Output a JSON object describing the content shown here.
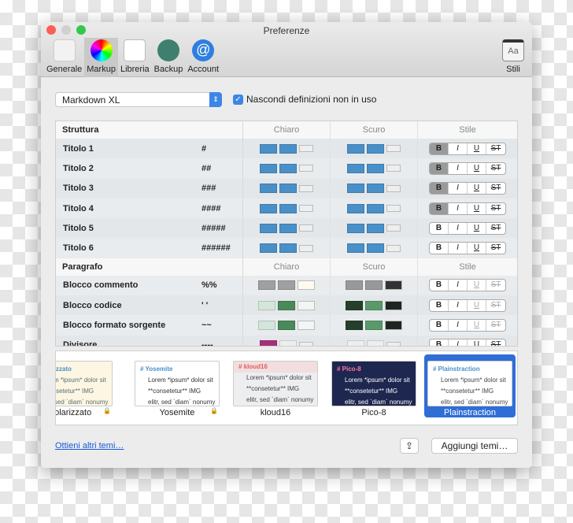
{
  "window": {
    "title": "Preferenze"
  },
  "toolbar": {
    "items": [
      {
        "label": "Generale",
        "icon": "switch-icon"
      },
      {
        "label": "Markup",
        "icon": "color-wheel-icon",
        "active": true
      },
      {
        "label": "Libreria",
        "icon": "library-icon"
      },
      {
        "label": "Backup",
        "icon": "backup-clock-icon"
      },
      {
        "label": "Account",
        "icon": "at-icon"
      }
    ],
    "stili": "Stili"
  },
  "markup_select": {
    "value": "Markdown XL"
  },
  "hide_unused": {
    "label": "Nascondi definizioni non in uso",
    "checked": true
  },
  "style_buttons": [
    "B",
    "I",
    "U",
    "ST"
  ],
  "sections": [
    {
      "title": "Struttura",
      "cols": [
        "Chiaro",
        "Scuro",
        "Stile"
      ],
      "rows": [
        {
          "name": "Titolo 1",
          "syntax": "#",
          "light": [
            "#4a90c8",
            "#4a90c8",
            "#eeeeee"
          ],
          "dark": [
            "#4a90c8",
            "#4a90c8",
            "#eeeeee"
          ],
          "bold": true,
          "dim": []
        },
        {
          "name": "Titolo 2",
          "syntax": "##",
          "light": [
            "#4a90c8",
            "#4a90c8",
            "#eeeeee"
          ],
          "dark": [
            "#4a90c8",
            "#4a90c8",
            "#eeeeee"
          ],
          "bold": true,
          "dim": []
        },
        {
          "name": "Titolo 3",
          "syntax": "###",
          "light": [
            "#4a90c8",
            "#4a90c8",
            "#eeeeee"
          ],
          "dark": [
            "#4a90c8",
            "#4a90c8",
            "#eeeeee"
          ],
          "bold": true,
          "dim": []
        },
        {
          "name": "Titolo 4",
          "syntax": "####",
          "light": [
            "#4a90c8",
            "#4a90c8",
            "#eeeeee"
          ],
          "dark": [
            "#4a90c8",
            "#4a90c8",
            "#eeeeee"
          ],
          "bold": true,
          "dim": []
        },
        {
          "name": "Titolo 5",
          "syntax": "#####",
          "light": [
            "#4a90c8",
            "#4a90c8",
            "#eeeeee"
          ],
          "dark": [
            "#4a90c8",
            "#4a90c8",
            "#eeeeee"
          ],
          "bold": false,
          "dim": []
        },
        {
          "name": "Titolo 6",
          "syntax": "######",
          "light": [
            "#4a90c8",
            "#4a90c8",
            "#eeeeee"
          ],
          "dark": [
            "#4a90c8",
            "#4a90c8",
            "#eeeeee"
          ],
          "bold": false,
          "dim": []
        }
      ]
    },
    {
      "title": "Paragrafo",
      "cols": [
        "Chiaro",
        "Scuro",
        "Stile"
      ],
      "rows": [
        {
          "name": "Blocco commento",
          "syntax": "%%",
          "light": [
            "#a0a0a0",
            "#a0a0a0",
            "#fdfbee"
          ],
          "dark": [
            "#999999",
            "#999999",
            "#333333"
          ],
          "bold": false,
          "dim": [
            2,
            3
          ]
        },
        {
          "name": "Blocco codice",
          "syntax": "' '",
          "light": [
            "#d2e6da",
            "#4a8a5a",
            "#f2f5f3"
          ],
          "dark": [
            "#24402c",
            "#5a9a6a",
            "#1e2620"
          ],
          "bold": false,
          "dim": [
            2,
            3
          ]
        },
        {
          "name": "Blocco formato sorgente",
          "syntax": "~~",
          "light": [
            "#d2e6da",
            "#4a8a5a",
            "#f2f5f3"
          ],
          "dark": [
            "#24402c",
            "#5a9a6a",
            "#1e2620"
          ],
          "bold": false,
          "dim": [
            2,
            3
          ]
        },
        {
          "name": "Divisore",
          "syntax": "----",
          "light": [
            "#a8307a",
            "#eeeeee",
            "#eeeeee"
          ],
          "dark": [
            "#eeeeee",
            "#eeeeee",
            "#eeeeee"
          ],
          "bold": false,
          "dim": []
        }
      ]
    }
  ],
  "themes": [
    {
      "name": "Solarizzato",
      "heading": "# Solarizzato",
      "bg": "#fdf6e3",
      "fg": "#586e75",
      "locked": true
    },
    {
      "name": "Yosemite",
      "heading": "# Yosemite",
      "bg": "#ffffff",
      "fg": "#333333",
      "locked": true
    },
    {
      "name": "kloud16",
      "heading": "# kloud16",
      "bg": "#eceef0",
      "fg": "#444444",
      "hbg": "#f2dede",
      "hcolor": "#e06060"
    },
    {
      "name": "Pico-8",
      "heading": "# Pico-8",
      "bg": "#1d2750",
      "fg": "#ffffff",
      "hcolor": "#ff77a8"
    },
    {
      "name": "Plainstraction",
      "heading": "# Plainstraction",
      "bg": "#ffffff",
      "fg": "#444444",
      "selected": true
    }
  ],
  "theme_sample": [
    "Lorem *ipsum* dolor sit",
    "**consetetur** IMG",
    "elitr, sed `diam` nonumy"
  ],
  "footer": {
    "link": "Ottieni altri temi…",
    "share_icon": "share-icon",
    "add": "Aggiungi temi…"
  }
}
